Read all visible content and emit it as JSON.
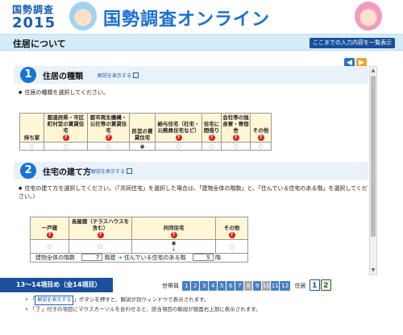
{
  "header": {
    "logo_top": "国勢調査",
    "logo_year": "2015",
    "brand": "国勢調査オンライン"
  },
  "titlebar": {
    "title": "住居について",
    "list_button": "ここまでの入力内容を一覧表示"
  },
  "section1": {
    "number": "1",
    "title": "住居の種類",
    "help": "解説を表示する",
    "instruction": "住居の種類を選択してください。",
    "columns": [
      "持ち家",
      "都道府県・市区町村営の賃貸住宅",
      "都市再生機構・公社等の賃貸住宅",
      "民営の賃貸住宅",
      "給与住宅（社宅・公務員住宅など）",
      "住宅に間借り",
      "会社等の独身寮・寄宿舎",
      "その他"
    ],
    "selected_index": 3
  },
  "section2": {
    "number": "2",
    "title": "住宅の建て方",
    "help": "解説を表示する",
    "instruction": "住宅の建て方を選択してください。（「共同住宅」を選択した場合は、「建物全体の階数」と、「住んでいる住宅のある階」を選択してください。）",
    "columns": [
      "一戸建",
      "長屋建（テラスハウスを含む）",
      "共同住宅",
      "その他"
    ],
    "selected_index": 2,
    "floors_label": "建物全体の階数",
    "floors_value": "7",
    "floors_unit": "階建",
    "my_floor_label": "住んでいる住宅のある階",
    "my_floor_value": "5",
    "my_floor_unit": "階"
  },
  "pagination": {
    "count_text": "13～14項目め（全14項目）",
    "household_label": "世帯員",
    "pages": [
      "1",
      "2",
      "3",
      "4",
      "5",
      "6",
      "7",
      "8",
      "9",
      "10",
      "11",
      "12"
    ],
    "residence_label": "住居",
    "residence_pages": [
      "1",
      "2"
    ],
    "current_residence_page": "2"
  },
  "notes": {
    "note1_tag": "解説を表示する",
    "note1_text": "ボタンを押すと、解説が別ウィンドウで表示されます。",
    "note2_text": "「❓」付きの項目にマウスカーソルを合わせると、該当項目の解説が画面右上部に表示されます。"
  }
}
